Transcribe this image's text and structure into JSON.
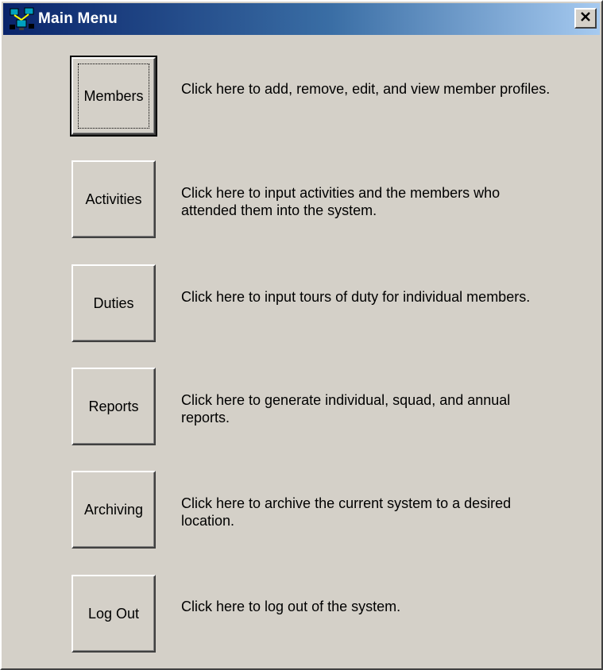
{
  "window": {
    "title": "Main Menu",
    "app_icon": "network-computers-icon",
    "close_icon": "close-x-icon"
  },
  "menu": [
    {
      "key": "members",
      "label": "Members",
      "description": "Click here to add, remove, edit, and view member profiles.",
      "focused": true
    },
    {
      "key": "activities",
      "label": "Activities",
      "description": "Click here to input activities and the members who attended them into the system."
    },
    {
      "key": "duties",
      "label": "Duties",
      "description": "Click here to input tours of duty for individual members."
    },
    {
      "key": "reports",
      "label": "Reports",
      "description": "Click here to generate individual, squad, and annual reports."
    },
    {
      "key": "archiving",
      "label": "Archiving",
      "description": "Click here to archive the current system to a desired location."
    },
    {
      "key": "logout",
      "label": "Log Out",
      "description": "Click here to log out of the system."
    }
  ],
  "colors": {
    "titlebar_start": "#0a246a",
    "titlebar_end": "#a6caf0",
    "face": "#d4d0c8"
  }
}
